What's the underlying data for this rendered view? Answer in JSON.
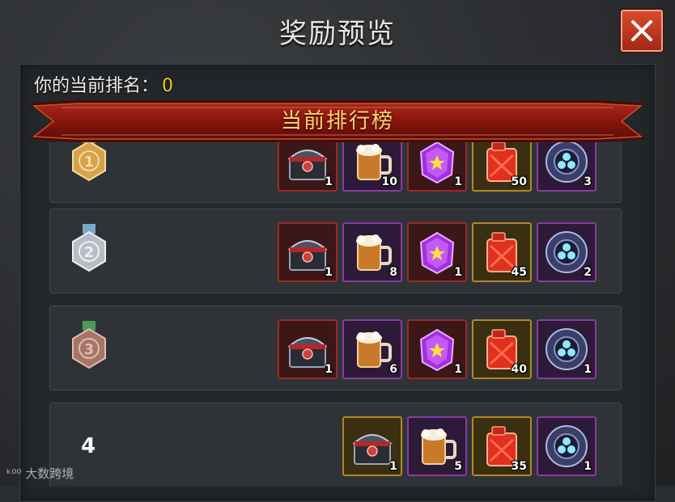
{
  "window": {
    "title": "奖励预览",
    "close_label": "✕"
  },
  "player": {
    "rank_label": "你的当前排名：",
    "rank_value": "0"
  },
  "banner": {
    "label": "当前排行榜"
  },
  "rows": [
    {
      "rank": "1",
      "medal": "gold-medal-icon",
      "items": [
        {
          "icon": "chest-icon",
          "tier": "red",
          "count": "1"
        },
        {
          "icon": "beer-mug-icon",
          "tier": "purple",
          "count": "10"
        },
        {
          "icon": "purple-crystal-icon",
          "tier": "red",
          "count": "1"
        },
        {
          "icon": "fuel-can-icon",
          "tier": "gold",
          "count": "50"
        },
        {
          "icon": "orb-icon",
          "tier": "purple",
          "count": "3"
        }
      ]
    },
    {
      "rank": "2",
      "medal": "silver-medal-icon",
      "items": [
        {
          "icon": "chest-icon",
          "tier": "red",
          "count": "1"
        },
        {
          "icon": "beer-mug-icon",
          "tier": "purple",
          "count": "8"
        },
        {
          "icon": "purple-crystal-icon",
          "tier": "red",
          "count": "1"
        },
        {
          "icon": "fuel-can-icon",
          "tier": "gold",
          "count": "45"
        },
        {
          "icon": "orb-icon",
          "tier": "purple",
          "count": "2"
        }
      ]
    },
    {
      "rank": "3",
      "medal": "bronze-medal-icon",
      "items": [
        {
          "icon": "chest-icon",
          "tier": "red",
          "count": "1"
        },
        {
          "icon": "beer-mug-icon",
          "tier": "purple",
          "count": "6"
        },
        {
          "icon": "purple-crystal-icon",
          "tier": "red",
          "count": "1"
        },
        {
          "icon": "fuel-can-icon",
          "tier": "gold",
          "count": "40"
        },
        {
          "icon": "orb-icon",
          "tier": "purple",
          "count": "1"
        }
      ]
    },
    {
      "rank": "4",
      "medal": "",
      "items": [
        {
          "icon": "chest-icon",
          "tier": "gold",
          "count": "1"
        },
        {
          "icon": "beer-mug-icon",
          "tier": "purple",
          "count": "5"
        },
        {
          "icon": "fuel-can-icon",
          "tier": "gold",
          "count": "35"
        },
        {
          "icon": "orb-icon",
          "tier": "purple",
          "count": "1"
        }
      ]
    }
  ],
  "watermark": {
    "text": "大数跨境"
  },
  "colors": {
    "accent_gold": "#f0d020",
    "banner_red": "#8e1b16",
    "close_red": "#c0331c"
  }
}
